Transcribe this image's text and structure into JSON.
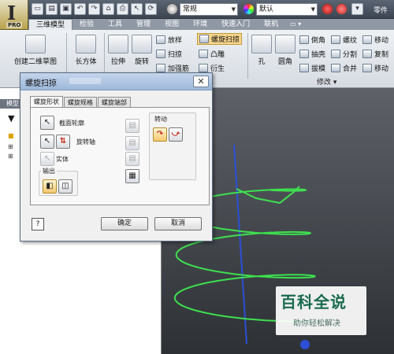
{
  "app": {
    "logo_letter": "I",
    "edition": "PRO"
  },
  "qat": {
    "style_combo": "常规",
    "color_combo": "默认",
    "right_label": "零件"
  },
  "tabs": [
    "三维模型",
    "检验",
    "工具",
    "管理",
    "视图",
    "环境",
    "快速入门",
    "联机"
  ],
  "ribbon": {
    "sketch": "创建二维草图",
    "box": "长方体",
    "extrude": "拉伸",
    "revolve": "旋转",
    "loft": "放样",
    "sweep": "扫掠",
    "rib": "加强筋",
    "coil": "螺旋扫掠",
    "emboss": "凸雕",
    "derive": "衍生",
    "hole": "孔",
    "fillet": "圆角",
    "chamfer": "倒角",
    "shell": "抽壳",
    "draft": "拔模",
    "thread": "螺纹",
    "split": "分割",
    "combine": "合并",
    "move": "移动",
    "copy": "复制",
    "move2": "移动",
    "modify_label": "修改 ▾"
  },
  "browser": {
    "header": "模型"
  },
  "dialog": {
    "title": "螺旋扫掠",
    "tabs": [
      "螺旋形状",
      "螺旋规格",
      "螺旋端部"
    ],
    "profile": "截面轮廓",
    "axis": "旋转轴",
    "solid": "实体",
    "output": "输出",
    "rotation": "转动",
    "ok": "确定",
    "cancel": "取消",
    "help": "?"
  },
  "watermark": {
    "title": "百科全说",
    "subtitle": "助你轻松解决"
  },
  "colors": {
    "helix": "#3ee04f",
    "axis": "#2c4fd6",
    "watermark_green": "#1a6b4e"
  }
}
